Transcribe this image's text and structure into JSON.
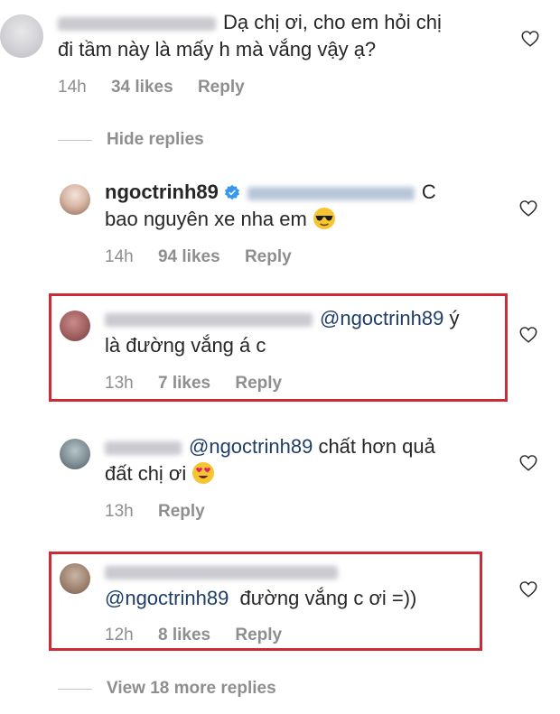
{
  "comments": [
    {
      "text": "Dạ chị ơi, cho em hỏi chị đi tầm này là mấy h mà vắng vậy ạ?",
      "line1": "Dạ chị ơi, cho em hỏi chị",
      "line2": "đi tầm này là mấy h mà vắng vậy ạ?",
      "time": "14h",
      "likes": "34 likes",
      "reply": "Reply"
    }
  ],
  "hide_replies": "Hide replies",
  "replies": [
    {
      "username": "ngoctrinh89",
      "line1_suffix": "C",
      "line2": "bao nguyên xe nha em",
      "emoji": "sunglasses-emoji",
      "time": "14h",
      "likes": "94 likes",
      "reply": "Reply"
    },
    {
      "mention": "@ngoctrinh89",
      "line1_suffix": "ý",
      "line2": "là đường vắng á c",
      "time": "13h",
      "likes": "7 likes",
      "reply": "Reply"
    },
    {
      "mention": "@ngoctrinh89",
      "line1_suffix": "chất hơn quả",
      "line2": "đất chị ơi",
      "emoji": "heart-eyes-emoji",
      "time": "13h",
      "reply": "Reply"
    },
    {
      "mention": "@ngoctrinh89",
      "line2_suffix": "đường vắng c ơi =))",
      "time": "12h",
      "likes": "8 likes",
      "reply": "Reply"
    }
  ],
  "view_more": "View 18 more replies",
  "colors": {
    "highlight_border": "#cc2a36",
    "mention": "#1f3e67",
    "meta": "#8e8e8e",
    "verified": "#3897f0"
  }
}
